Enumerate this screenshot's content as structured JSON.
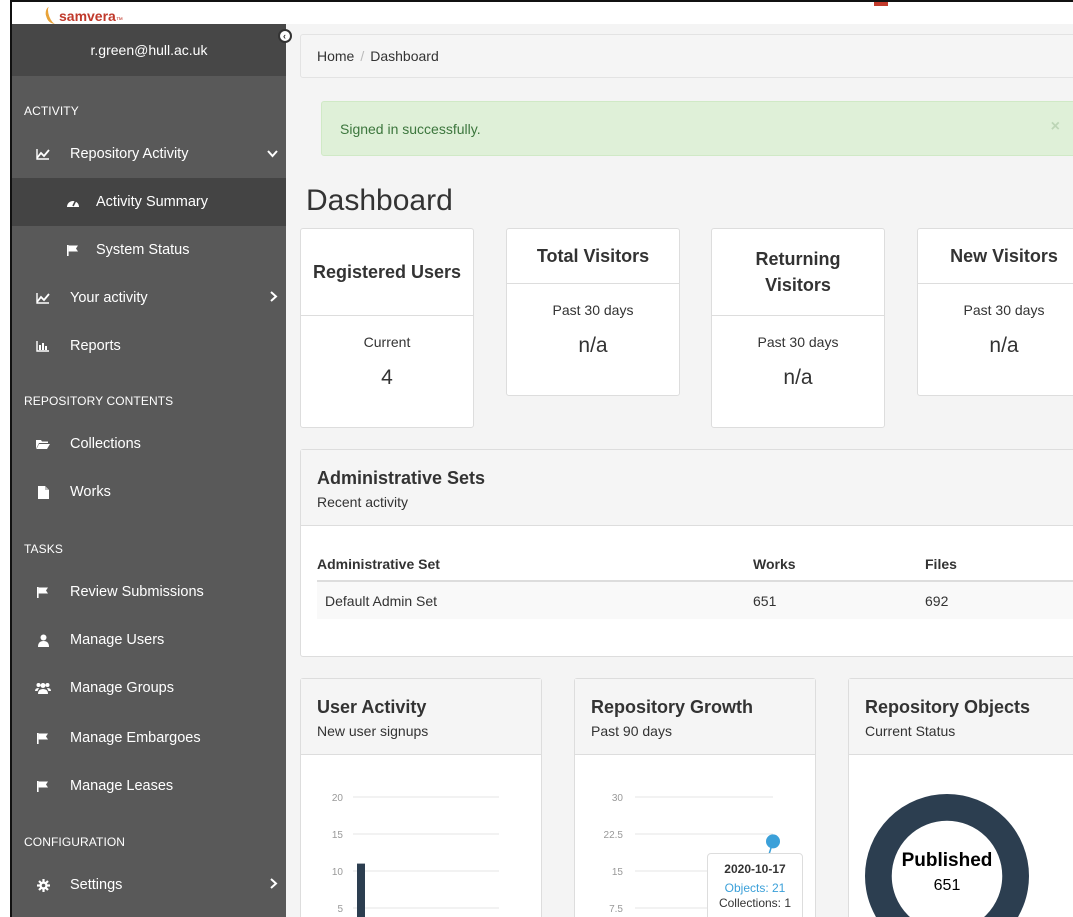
{
  "brand": {
    "name": "samvera",
    "tm": "™"
  },
  "sidebar": {
    "user": "r.green@hull.ac.uk",
    "collapse_icon": "chevron-left-icon",
    "sections": [
      {
        "label": "ACTIVITY"
      },
      {
        "label": "REPOSITORY CONTENTS"
      },
      {
        "label": "TASKS"
      },
      {
        "label": "CONFIGURATION"
      }
    ],
    "items": [
      {
        "label": "Repository Activity",
        "icon": "line-chart-icon"
      },
      {
        "label": "Activity Summary",
        "icon": "dashboard-icon"
      },
      {
        "label": "System Status",
        "icon": "flag-icon"
      },
      {
        "label": "Your activity",
        "icon": "line-chart-icon"
      },
      {
        "label": "Reports",
        "icon": "bar-chart-icon"
      },
      {
        "label": "Collections",
        "icon": "folder-open-icon"
      },
      {
        "label": "Works",
        "icon": "file-icon"
      },
      {
        "label": "Review Submissions",
        "icon": "flag-icon"
      },
      {
        "label": "Manage Users",
        "icon": "user-icon"
      },
      {
        "label": "Manage Groups",
        "icon": "users-icon"
      },
      {
        "label": "Manage Embargoes",
        "icon": "flag-icon"
      },
      {
        "label": "Manage Leases",
        "icon": "flag-icon"
      },
      {
        "label": "Settings",
        "icon": "gear-icon"
      }
    ]
  },
  "breadcrumb": {
    "home": "Home",
    "separator": "/",
    "current": "Dashboard"
  },
  "alert": {
    "message": "Signed in successfully.",
    "close": "×"
  },
  "page_title": "Dashboard",
  "stats": [
    {
      "title": "Registered Users",
      "subtitle": "Current",
      "value": "4"
    },
    {
      "title": "Total Visitors",
      "subtitle": "Past 30 days",
      "value": "n/a"
    },
    {
      "title": "Returning Visitors",
      "subtitle": "Past 30 days",
      "value": "n/a"
    },
    {
      "title": "New Visitors",
      "subtitle": "Past 30 days",
      "value": "n/a"
    }
  ],
  "admin_sets": {
    "title": "Administrative Sets",
    "subtitle": "Recent activity",
    "columns": [
      "Administrative Set",
      "Works",
      "Files"
    ],
    "rows": [
      [
        "Default Admin Set",
        "651",
        "692"
      ]
    ]
  },
  "user_activity": {
    "title": "User Activity",
    "subtitle": "New user signups"
  },
  "repo_growth": {
    "title": "Repository Growth",
    "subtitle": "Past 90 days",
    "tooltip": {
      "date": "2020-10-17",
      "objects": "Objects: 21",
      "collections": "Collections: 1"
    }
  },
  "repo_objects": {
    "title": "Repository Objects",
    "subtitle": "Current Status",
    "center_label": "Published",
    "center_value": "651"
  },
  "colors": {
    "sidebar_bg": "#595959",
    "sidebar_dark": "#474747",
    "accent_blue": "#3ba0d9",
    "bar_dark": "#2c3e50",
    "donut": "#2c3e50",
    "alert_bg": "#dff0d8",
    "alert_text": "#3c763d"
  },
  "chart_data": [
    {
      "type": "bar",
      "yticks": [
        "20",
        "15",
        "10",
        "5"
      ],
      "ylim": [
        0,
        20
      ],
      "series": [
        {
          "values": [
            11
          ]
        }
      ]
    },
    {
      "type": "line",
      "yticks": [
        "30",
        "22.5",
        "15",
        "7.5"
      ],
      "ylim": [
        0,
        30
      ],
      "points": [
        {
          "x": "2020-10-17",
          "objects": 21,
          "collections": 1
        }
      ]
    },
    {
      "type": "pie",
      "slices": [
        {
          "label": "Published",
          "value": 651
        }
      ]
    }
  ]
}
